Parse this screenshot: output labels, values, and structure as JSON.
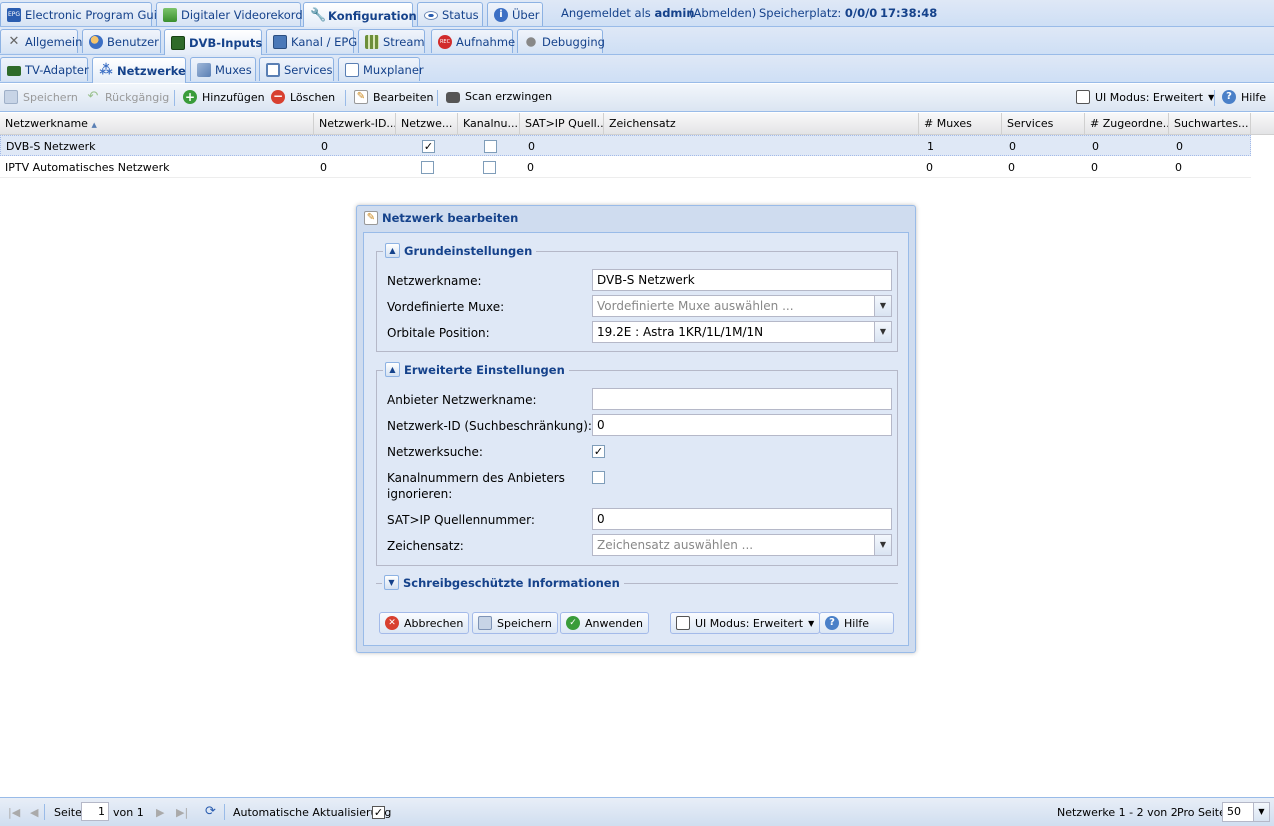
{
  "top_tabs": [
    {
      "label": "Electronic Program Guide",
      "icon": "epg-icon"
    },
    {
      "label": "Digitaler Videorekorder",
      "icon": "download-icon"
    },
    {
      "label": "Konfiguration",
      "icon": "wrench-icon"
    },
    {
      "label": "Status",
      "icon": "eye-icon"
    },
    {
      "label": "Über",
      "icon": "info-icon"
    }
  ],
  "session": {
    "logged_in_prefix": "Angemeldet als",
    "user": "admin",
    "logout": "(Abmelden)",
    "storage_label": "Speicherplatz:",
    "storage_value": "0/0/0",
    "clock": "17:38:48"
  },
  "config_tabs": [
    {
      "label": "Allgemein"
    },
    {
      "label": "Benutzer"
    },
    {
      "label": "DVB-Inputs"
    },
    {
      "label": "Kanal / EPG"
    },
    {
      "label": "Stream"
    },
    {
      "label": "Aufnahme"
    },
    {
      "label": "Debugging"
    }
  ],
  "dvb_tabs": [
    {
      "label": "TV-Adapter"
    },
    {
      "label": "Netzwerke"
    },
    {
      "label": "Muxes"
    },
    {
      "label": "Services"
    },
    {
      "label": "Muxplaner"
    }
  ],
  "toolbar": {
    "save": "Speichern",
    "undo": "Rückgängig",
    "add": "Hinzufügen",
    "delete": "Löschen",
    "edit": "Bearbeiten",
    "force_scan": "Scan erzwingen",
    "ui_mode": "UI Modus: Erweitert",
    "help": "Hilfe"
  },
  "grid": {
    "columns": [
      "Netzwerkname",
      "Netzwerk-ID...",
      "Netzwe...",
      "Kanalnu...",
      "SAT>IP Quell...",
      "Zeichensatz",
      "# Muxes",
      "Services",
      "# Zugeordne...",
      "Suchwartes..."
    ],
    "rows": [
      {
        "name": "DVB-S Netzwerk",
        "network_id": "0",
        "network_search": true,
        "ignore_chnum": false,
        "satip_src": "0",
        "charset": "",
        "muxes": "1",
        "services": "0",
        "mapped": "0",
        "scan_queue": "0"
      },
      {
        "name": "IPTV Automatisches Netzwerk",
        "network_id": "0",
        "network_search": false,
        "ignore_chnum": false,
        "satip_src": "0",
        "charset": "",
        "muxes": "0",
        "services": "0",
        "mapped": "0",
        "scan_queue": "0"
      }
    ]
  },
  "dialog": {
    "title": "Netzwerk bearbeiten",
    "basic": {
      "legend": "Grundeinstellungen",
      "network_name_label": "Netzwerkname:",
      "network_name_value": "DVB-S Netzwerk",
      "predefined_muxes_label": "Vordefinierte Muxe:",
      "predefined_muxes_placeholder": "Vordefinierte Muxe auswählen ...",
      "orbital_label": "Orbitale Position:",
      "orbital_value": "19.2E : Astra 1KR/1L/1M/1N"
    },
    "advanced": {
      "legend": "Erweiterte Einstellungen",
      "provider_name_label": "Anbieter Netzwerkname:",
      "provider_name_value": "",
      "network_id_label": "Netzwerk-ID (Suchbeschränkung):",
      "network_id_value": "0",
      "network_search_label": "Netzwerksuche:",
      "network_search_checked": true,
      "ignore_chnum_label_1": "Kanalnummern des Anbieters",
      "ignore_chnum_label_2": "ignorieren:",
      "ignore_chnum_checked": false,
      "satip_label": "SAT>IP Quellennummer:",
      "satip_value": "0",
      "charset_label": "Zeichensatz:",
      "charset_placeholder": "Zeichensatz auswählen ..."
    },
    "readonly": {
      "legend": "Schreibgeschützte Informationen"
    },
    "buttons": {
      "cancel": "Abbrechen",
      "save": "Speichern",
      "apply": "Anwenden",
      "ui_mode": "UI Modus: Erweitert",
      "help": "Hilfe"
    }
  },
  "statusbar": {
    "page_label": "Seite",
    "page_value": "1",
    "of_label": "von 1",
    "auto_refresh": "Automatische Aktualisierung",
    "auto_refresh_checked": true,
    "summary": "Netzwerke 1 - 2 von 2",
    "per_page_label": "Pro Seite",
    "per_page_value": "50"
  }
}
